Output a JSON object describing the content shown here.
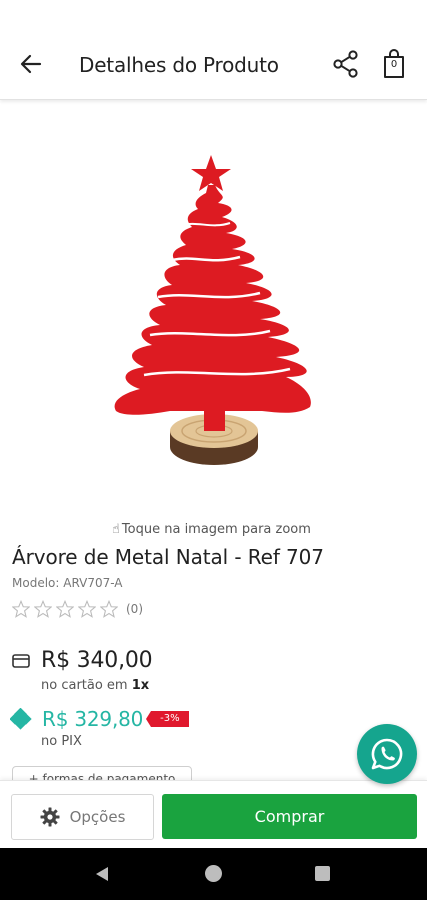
{
  "header": {
    "title": "Detalhes do Produto",
    "bag_count": "0",
    "icons": [
      "arrow-left-icon",
      "share-icon",
      "shopping-bag-icon"
    ]
  },
  "product": {
    "image": "red-metal-christmas-tree-on-wood-base",
    "zoom_hint": "Toque na imagem para zoom",
    "title": "Árvore de Metal Natal - Ref 707",
    "model": "Modelo: ARV707-A",
    "rating": {
      "stars": 0,
      "max": 5,
      "count_label": "(0)"
    }
  },
  "pricing": {
    "card_price": "R$ 340,00",
    "card_note_prefix": "no cartão em ",
    "card_note_installments": "1x",
    "pix_price": "R$ 329,80",
    "pix_discount": "-3%",
    "pix_note": "no PIX",
    "more_payment_label": "+ formas de pagamento",
    "colors": {
      "pix": "#25b6a4",
      "discount": "#e0182d"
    }
  },
  "actions": {
    "options_label": "Opções",
    "buy_label": "Comprar",
    "buy_color": "#1aa33f",
    "whatsapp_color": "#15a58e"
  },
  "system_nav": {
    "icons": [
      "nav-back-icon",
      "nav-home-icon",
      "nav-recent-icon"
    ]
  }
}
